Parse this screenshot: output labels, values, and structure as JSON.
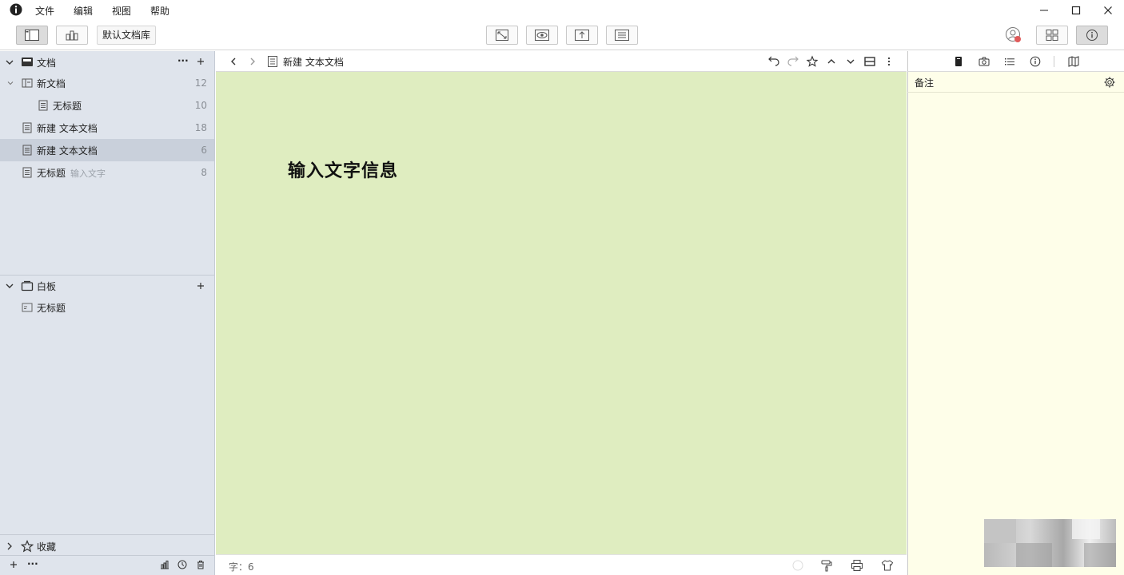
{
  "menu": {
    "items": [
      "文件",
      "编辑",
      "视图",
      "帮助"
    ]
  },
  "toolbar": {
    "library_label": "默认文档库"
  },
  "sidebar": {
    "docs_section": {
      "title": "文档"
    },
    "docs": [
      {
        "label": "新文档",
        "count": "12"
      },
      {
        "label": "无标题",
        "count": "10"
      },
      {
        "label": "新建 文本文档",
        "count": "18"
      },
      {
        "label": "新建 文本文档",
        "count": "6"
      },
      {
        "label": "无标题",
        "sub": "输入文字",
        "count": "8"
      }
    ],
    "board_section": {
      "title": "白板"
    },
    "boards": [
      {
        "label": "无标题"
      }
    ],
    "favorites": {
      "title": "收藏"
    },
    "bottom": {
      "more": "···"
    }
  },
  "editor": {
    "breadcrumb_title": "新建 文本文档",
    "content": "输入文字信息",
    "word_count": "字：6"
  },
  "right_panel": {
    "notes_title": "备注"
  },
  "colors": {
    "sidebar_bg": "#dfe4ec",
    "selected_row": "#c9d0db",
    "editor_bg": "#dfedc0",
    "notes_bg": "#fefee9"
  },
  "icons": [
    "app-info-icon",
    "minimize-icon",
    "maximize-icon",
    "close-icon",
    "sidebar-toggle-icon",
    "chart-icon",
    "fullscreen-icon",
    "preview-eye-icon",
    "export-icon",
    "outline-icon",
    "account-icon",
    "grid-icon",
    "info-icon",
    "back-icon",
    "forward-icon",
    "document-icon",
    "undo-icon",
    "redo-icon",
    "star-icon",
    "chevron-up-icon",
    "chevron-down-icon",
    "split-icon",
    "kebab-icon",
    "notebook-icon",
    "camera-icon",
    "list-icon",
    "map-icon",
    "gear-icon",
    "paint-roller-icon",
    "print-icon",
    "shirt-icon",
    "trash-icon",
    "history-icon",
    "stats-icon",
    "plus-icon"
  ]
}
